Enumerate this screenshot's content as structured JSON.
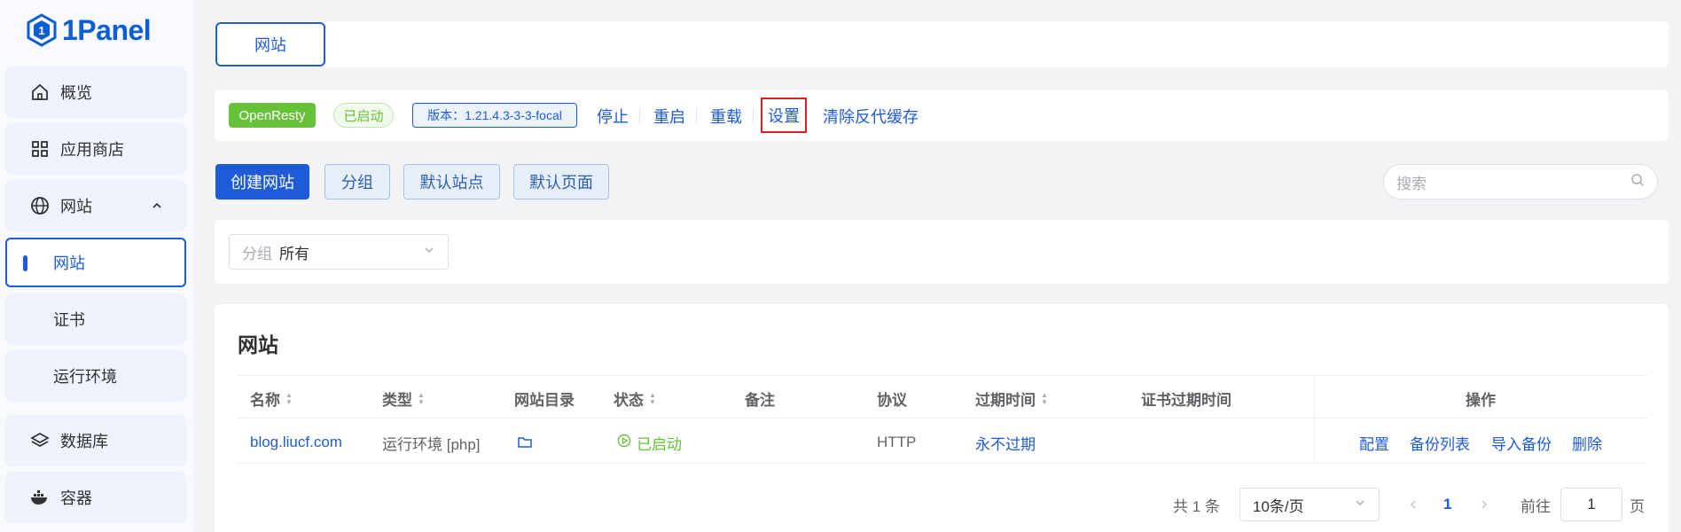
{
  "app": {
    "logo_text": "1Panel"
  },
  "sidebar": {
    "items": [
      {
        "label": "概览",
        "icon": "home-icon"
      },
      {
        "label": "应用商店",
        "icon": "grid-icon"
      },
      {
        "label": "网站",
        "icon": "globe-icon",
        "expanded": true
      },
      {
        "label": "网站",
        "sub": true,
        "active": true
      },
      {
        "label": "证书",
        "sub": true
      },
      {
        "label": "运行环境",
        "sub": true
      },
      {
        "label": "数据库",
        "icon": "layers-icon"
      },
      {
        "label": "容器",
        "icon": "docker-icon"
      }
    ]
  },
  "tabs": {
    "active": "网站"
  },
  "openresty": {
    "name": "OpenResty",
    "status": "已启动",
    "version": "版本：1.21.4.3-3-3-focal",
    "actions": [
      "停止",
      "重启",
      "重载",
      "设置",
      "清除反代缓存"
    ]
  },
  "toolbar": {
    "buttons": [
      "创建网站",
      "分组",
      "默认站点",
      "默认页面"
    ],
    "search_placeholder": "搜索"
  },
  "filter": {
    "label": "分组",
    "value": "所有"
  },
  "table": {
    "title": "网站",
    "columns": [
      "名称",
      "类型",
      "网站目录",
      "状态",
      "备注",
      "协议",
      "过期时间",
      "证书过期时间",
      "操作"
    ],
    "rows": [
      {
        "name": "blog.liucf.com",
        "type": "运行环境 [php]",
        "status": "已启动",
        "remark": "",
        "protocol": "HTTP",
        "expire": "永不过期",
        "ssl_expire": "",
        "ops": [
          "配置",
          "备份列表",
          "导入备份",
          "删除"
        ]
      }
    ]
  },
  "pagination": {
    "total": "共 1 条",
    "page_size": "10条/页",
    "current": "1",
    "goto_label": "前往",
    "goto_value": "1",
    "page_unit": "页"
  },
  "colors": {
    "primary": "#1e5bd8",
    "success": "#67c23a",
    "highlight": "#e02020"
  }
}
